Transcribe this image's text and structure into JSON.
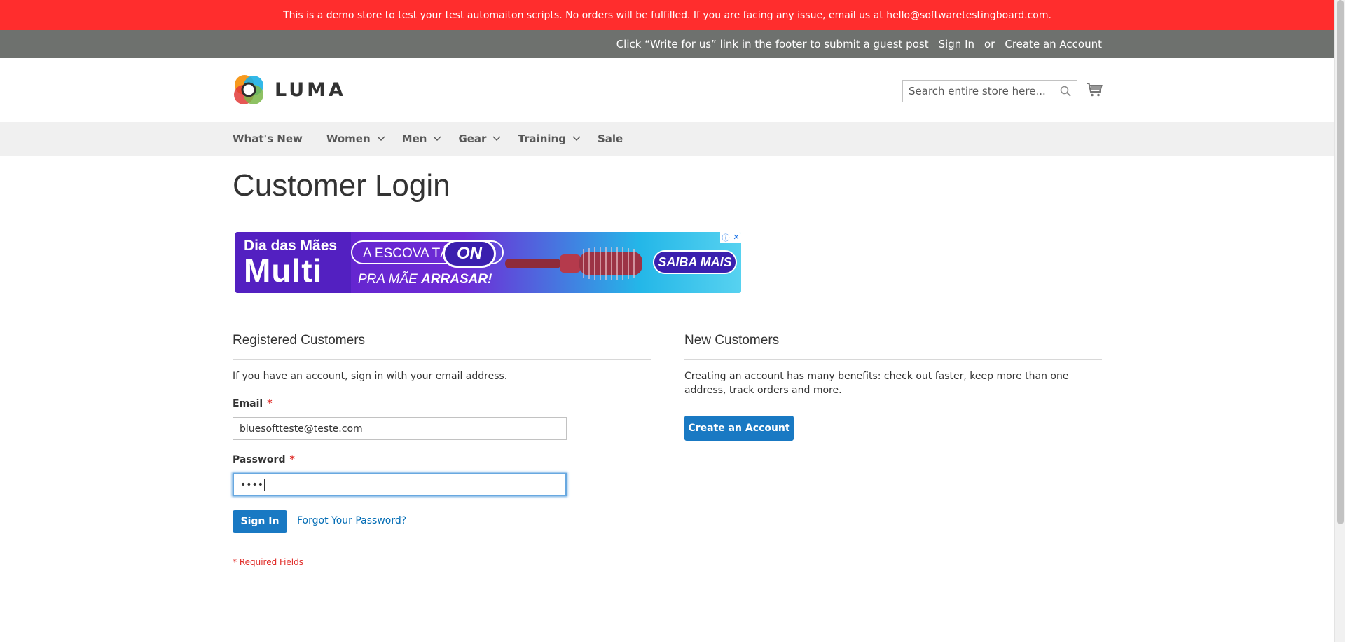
{
  "demo_notice": "This is a demo store to test your test automaiton scripts. No orders will be fulfilled. If you are facing any issue, email us at hello@softwaretestingboard.com.",
  "panel": {
    "guest_post": "Click “Write for us” link in the footer to submit a guest post",
    "sign_in": "Sign In",
    "or": "or",
    "create_account": "Create an Account"
  },
  "header": {
    "logo_text": "LUMA",
    "search_placeholder": "Search entire store here...",
    "search_icon": "search-icon",
    "cart_icon": "cart-icon"
  },
  "nav": {
    "items": [
      {
        "label": "What's New",
        "dropdown": false
      },
      {
        "label": "Women",
        "dropdown": true
      },
      {
        "label": "Men",
        "dropdown": true
      },
      {
        "label": "Gear",
        "dropdown": true
      },
      {
        "label": "Training",
        "dropdown": true
      },
      {
        "label": "Sale",
        "dropdown": false
      }
    ]
  },
  "page_title": "Customer Login",
  "ad": {
    "line1": "Dia das Mães",
    "line2": "Multi",
    "line3": "A ESCOVA TÁ",
    "on": "ON",
    "line4_a": "PRA MÃE",
    "line4_b": "ARRASAR!",
    "cta": "SAIBA MAIS",
    "info_icon": "ⓘ",
    "close_icon": "✕"
  },
  "registered": {
    "title": "Registered Customers",
    "intro": "If you have an account, sign in with your email address.",
    "email_label": "Email",
    "email_value": "bluesoftteste@teste.com",
    "password_label": "Password",
    "password_value": "••••",
    "required_mark": "*",
    "sign_in_button": "Sign In",
    "forgot_link": "Forgot Your Password?",
    "required_note": "* Required Fields"
  },
  "new_customers": {
    "title": "New Customers",
    "text": "Creating an account has many benefits: check out faster, keep more than one address, track orders and more.",
    "button": "Create an Account"
  },
  "colors": {
    "demo_bar": "#ff2d2d",
    "panel": "#6e716e",
    "nav_bg": "#f0f0f0",
    "primary": "#1979c3",
    "link": "#006bb4",
    "required": "#e02b27"
  }
}
